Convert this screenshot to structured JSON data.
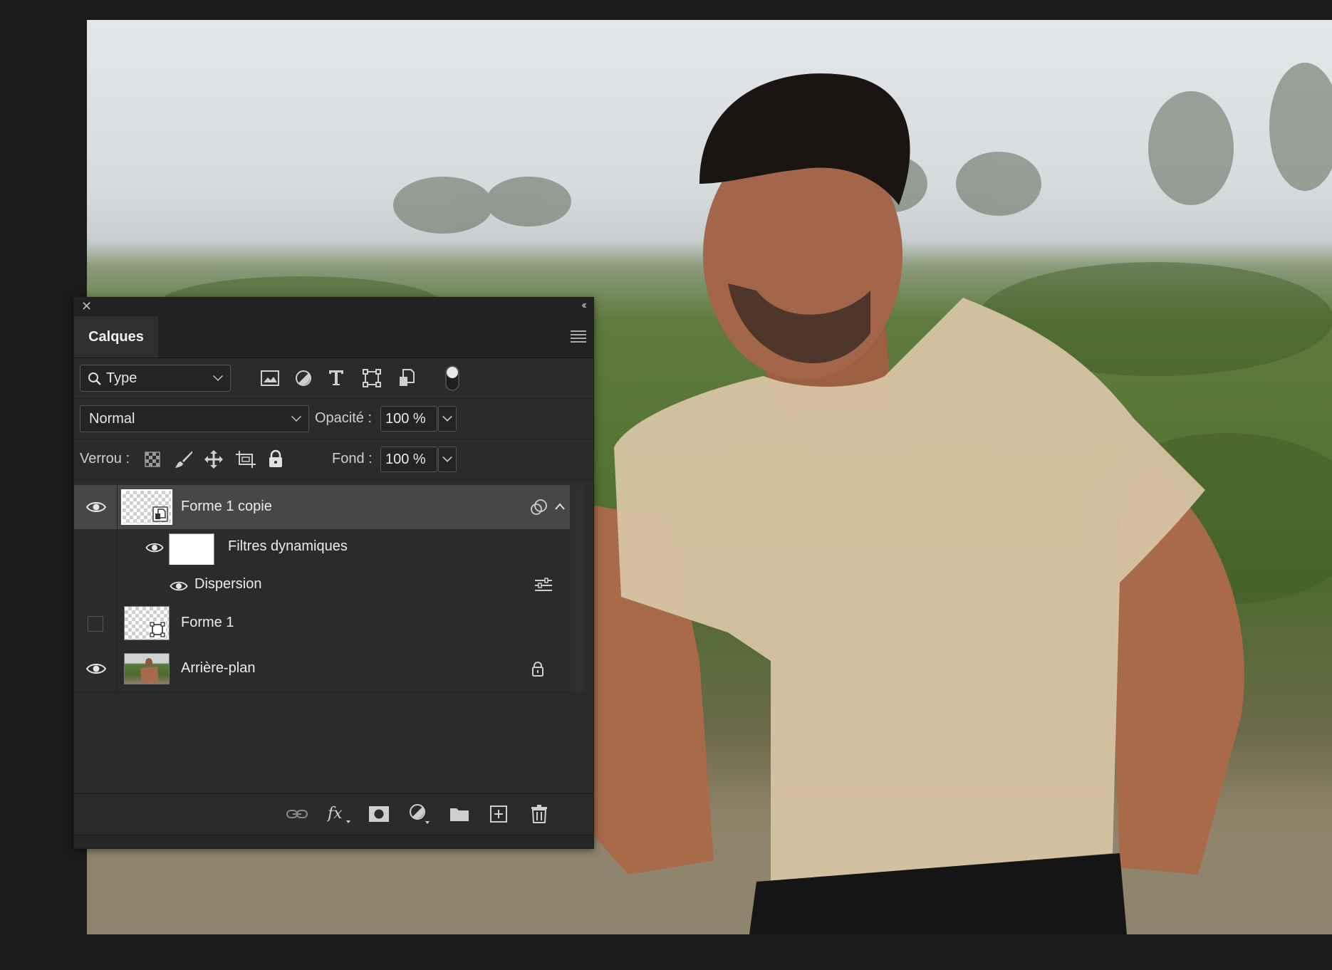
{
  "panel": {
    "close_glyph": "✕",
    "collapse_glyph": "‹‹",
    "tab_label": "Calques",
    "filter": {
      "label": "Type"
    },
    "filter_icons": [
      "image-filter-icon",
      "adjustment-filter-icon",
      "text-filter-icon",
      "shape-filter-icon",
      "smart-object-filter-icon",
      "filter-toggle-icon"
    ],
    "blend_mode": "Normal",
    "opacity_label": "Opacité :",
    "opacity_value": "100 %",
    "lock_label": "Verrou :",
    "lock_icons": [
      "lock-transparent-pixels-icon",
      "lock-image-pixels-icon",
      "lock-position-icon",
      "lock-artboard-icon",
      "lock-all-icon"
    ],
    "fill_label": "Fond :",
    "fill_value": "100 %",
    "layers": [
      {
        "name": "Forme 1 copie",
        "visible": true,
        "selected": true,
        "type": "smart-object"
      },
      {
        "name": "Filtres dynamiques",
        "visible": true,
        "type": "smart-filters"
      },
      {
        "name": "Dispersion",
        "visible": true,
        "type": "filter"
      },
      {
        "name": "Forme 1",
        "visible": false,
        "type": "shape"
      },
      {
        "name": "Arrière-plan",
        "visible": true,
        "locked": true,
        "type": "background"
      }
    ],
    "footer_icons": [
      "link-layers-icon",
      "fx-icon",
      "add-mask-icon",
      "new-adjustment-icon",
      "new-group-icon",
      "new-layer-icon",
      "delete-layer-icon"
    ]
  },
  "colors": {
    "panel_bg": "#2b2b2b",
    "selected_row": "#474747",
    "app_bg": "#1b1b1b",
    "shirt": "#d6c4a4"
  }
}
